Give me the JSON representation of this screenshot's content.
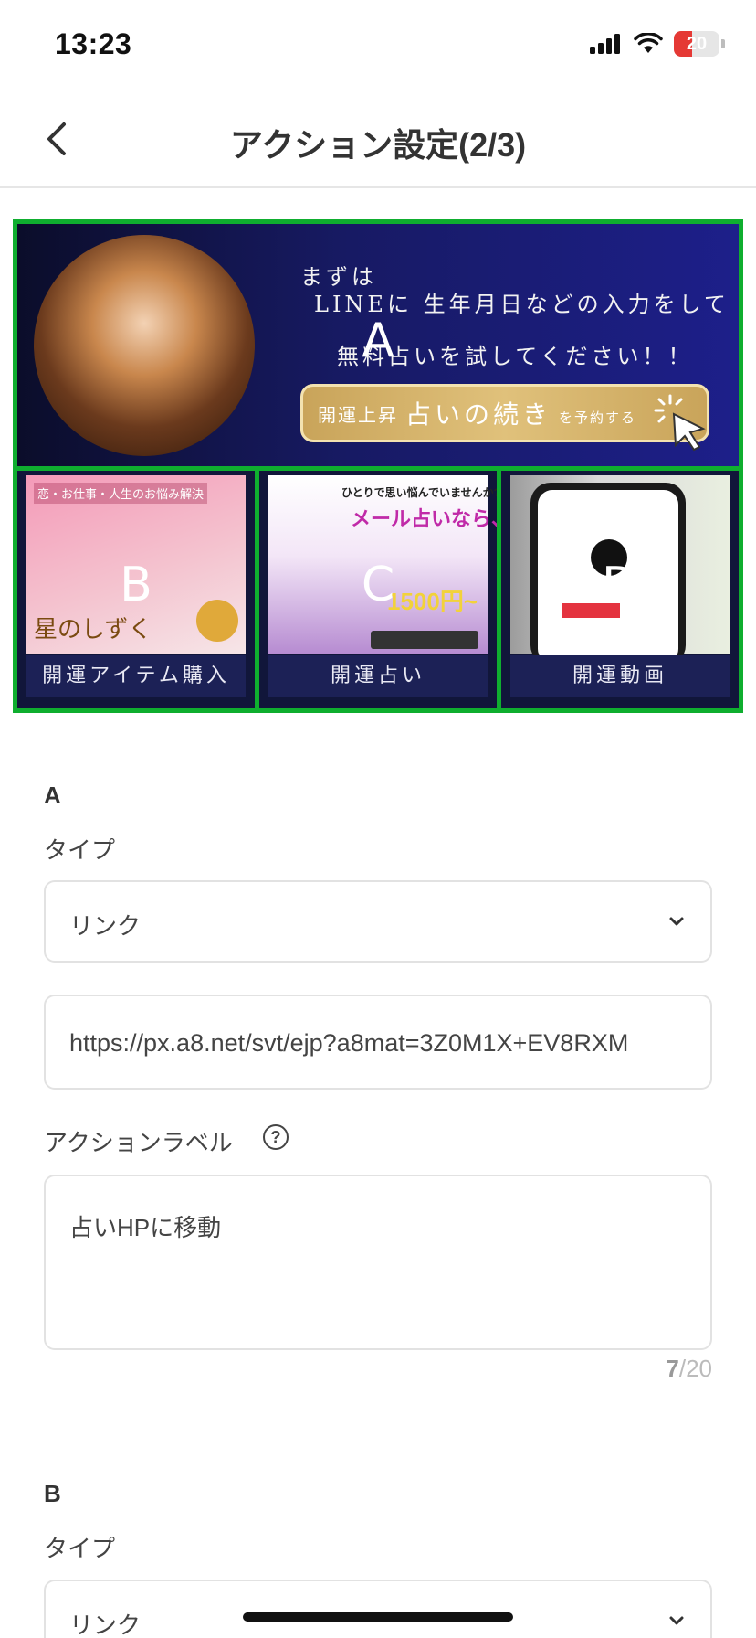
{
  "status_bar": {
    "time": "13:23",
    "battery_text": "20",
    "battery_level": 0.2,
    "battery_color": "#e53935",
    "icons": [
      "signal-icon",
      "wifi-icon",
      "battery-icon"
    ]
  },
  "header": {
    "title": "アクション設定(2/3)",
    "back_icon": "chevron-left-icon"
  },
  "preview": {
    "area_a": {
      "letter": "A",
      "line1": "まずは",
      "line2": "LINEに 生年月日などの入力をして",
      "line3": "無料占いを試してください！！",
      "cta_small": "開運上昇",
      "cta_large": "占いの続き",
      "cta_suffix": "を予約する"
    },
    "area_b": {
      "letter": "B",
      "label": "開運アイテム購入",
      "img_text": "恋・お仕事・人生のお悩み解決",
      "img_brand": "星のしずく"
    },
    "area_c": {
      "letter": "C",
      "label": "開運占い",
      "img_text1": "ひとりで思い悩んでいませんか?",
      "img_text2": "メール占いなら、",
      "img_price": "1500円~"
    },
    "area_d": {
      "letter": "D",
      "label": "開運動画"
    },
    "border_color": "#0fae2f"
  },
  "form": {
    "section_a": {
      "heading": "A",
      "type_label": "タイプ",
      "type_value": "リンク",
      "url_value": "https://px.a8.net/svt/ejp?a8mat=3Z0M1X+EV8RXM",
      "action_label_title": "アクションラベル",
      "help_icon": "?",
      "action_label_value": "占いHPに移動",
      "counter_current": "7",
      "counter_max": "/20"
    },
    "section_b": {
      "heading": "B",
      "type_label": "タイプ",
      "type_value": "リンク"
    }
  }
}
